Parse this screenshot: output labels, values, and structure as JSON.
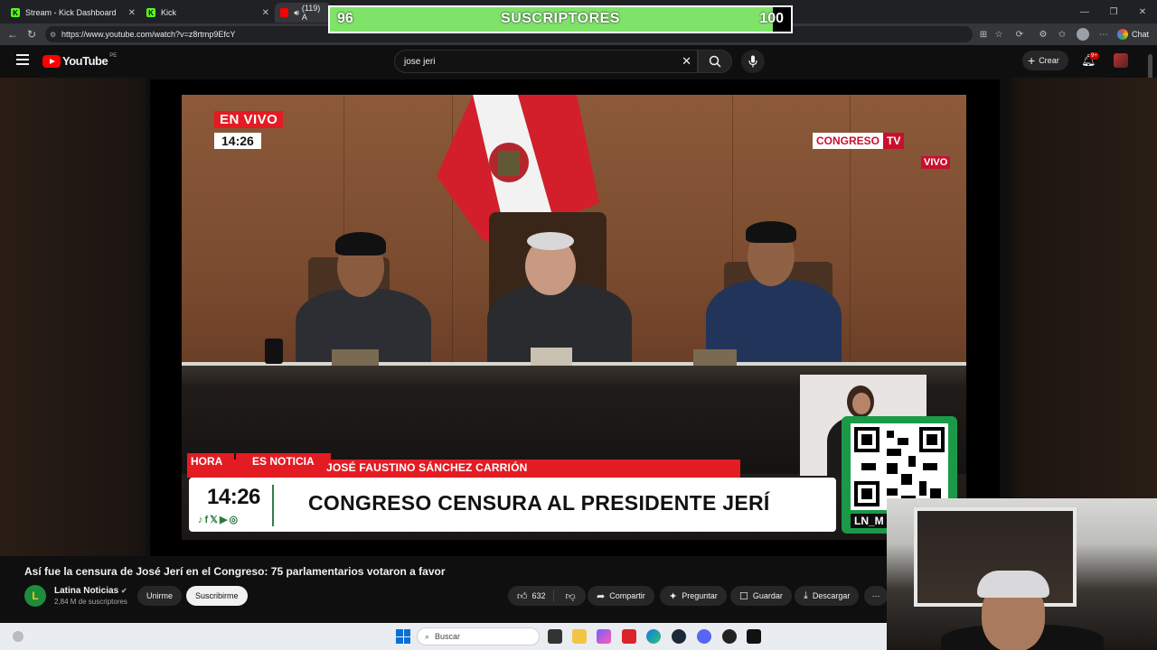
{
  "browser": {
    "tabs": [
      {
        "title": "Stream - Kick Dashboard",
        "favicon": "K"
      },
      {
        "title": "Kick",
        "favicon": "K"
      },
      {
        "title": "(119) A",
        "favicon": "youtube"
      }
    ],
    "url": "https://www.youtube.com/watch?v=z8rtmp9EfcY",
    "chat_label": "Chat"
  },
  "overlay": {
    "current": "96",
    "label": "SUSCRIPTORES",
    "goal": "100",
    "progress_fraction": 0.96,
    "fill_color": "#7fe36a"
  },
  "youtube": {
    "logo_text": "YouTube",
    "region": "PE",
    "search_query": "jose jeri",
    "create_label": "Crear",
    "notifications_badge": "9+"
  },
  "video": {
    "live_label": "EN VIVO",
    "live_time": "14:26",
    "network_a": "CONGRESO",
    "network_b": "TV",
    "vivo": "VIVO",
    "hora": "HORA",
    "es_noticia": "ES NOTICIA",
    "location": "JOSÉ FAUSTINO SÁNCHEZ CARRIÓN",
    "ticker_time": "14:26",
    "headline": "CONGRESO CENSURA AL PRESIDENTE JERÍ",
    "qr_label": "LN_M"
  },
  "meta": {
    "title": "Así fue la censura de José Jerí en el Congreso: 75 parlamentarios votaron a favor",
    "channel": "Latina Noticias",
    "subscribers": "2,84 M de suscriptores",
    "join_label": "Unirme",
    "subscribe_label": "Suscribirme",
    "likes": "632",
    "share_label": "Compartir",
    "ask_label": "Preguntar",
    "save_label": "Guardar",
    "download_label": "Descargar"
  },
  "taskbar": {
    "search_label": "Buscar"
  }
}
